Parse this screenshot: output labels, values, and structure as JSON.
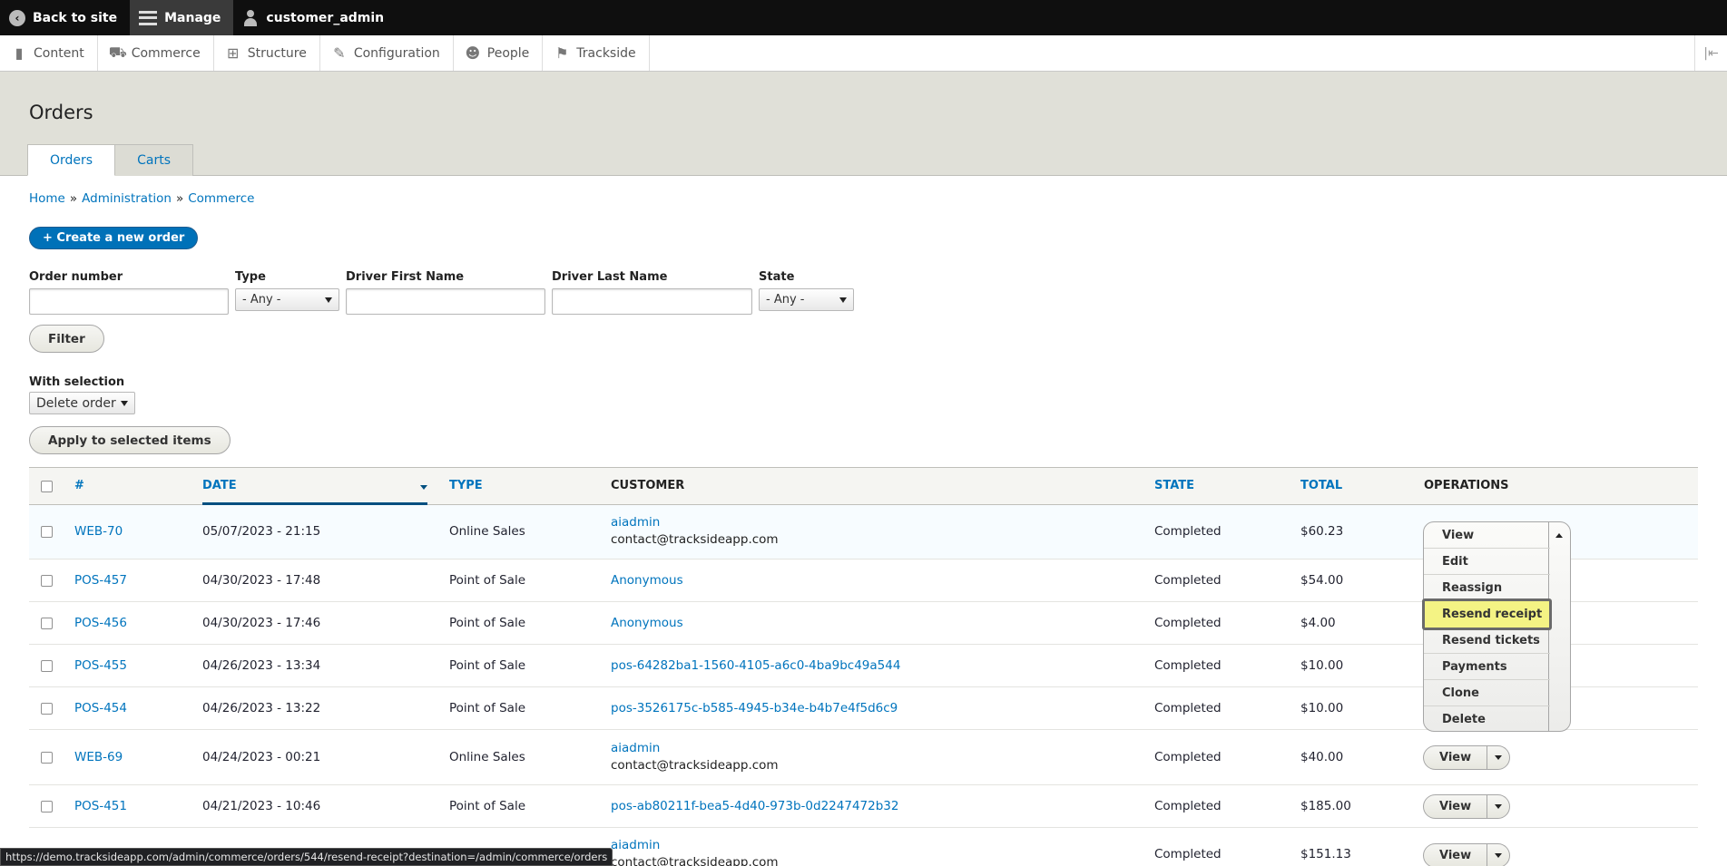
{
  "toolbar": {
    "back_label": "Back to site",
    "manage_label": "Manage",
    "user_label": "customer_admin"
  },
  "tray": {
    "items": [
      {
        "label": "Content",
        "icon": "file-icon"
      },
      {
        "label": "Commerce",
        "icon": "cart-icon"
      },
      {
        "label": "Structure",
        "icon": "sitemap-icon"
      },
      {
        "label": "Configuration",
        "icon": "wrench-icon"
      },
      {
        "label": "People",
        "icon": "people-icon"
      },
      {
        "label": "Trackside",
        "icon": "flag-icon"
      }
    ]
  },
  "page": {
    "title": "Orders",
    "tabs": [
      {
        "label": "Orders"
      },
      {
        "label": "Carts"
      }
    ]
  },
  "breadcrumb": {
    "items": [
      "Home",
      "Administration",
      "Commerce"
    ],
    "separator": "»"
  },
  "actions": {
    "create_label": "+ Create a new order"
  },
  "filters": {
    "order_number_label": "Order number",
    "type_label": "Type",
    "type_value": "- Any -",
    "first_name_label": "Driver First Name",
    "last_name_label": "Driver Last Name",
    "state_label": "State",
    "state_value": "- Any -",
    "filter_button": "Filter"
  },
  "bulk": {
    "label": "With selection",
    "value": "Delete order",
    "apply_button": "Apply to selected items"
  },
  "table": {
    "headers": {
      "number": "#",
      "date": "Date",
      "type": "Type",
      "customer": "Customer",
      "state": "State",
      "total": "Total",
      "operations": "Operations"
    },
    "rows": [
      {
        "number": "WEB-70",
        "date": "05/07/2023 - 21:15",
        "type": "Online Sales",
        "customer": "aiadmin",
        "email": "contact@tracksideapp.com",
        "state": "Completed",
        "total": "$60.23"
      },
      {
        "number": "POS-457",
        "date": "04/30/2023 - 17:48",
        "type": "Point of Sale",
        "customer": "Anonymous",
        "email": "",
        "state": "Completed",
        "total": "$54.00"
      },
      {
        "number": "POS-456",
        "date": "04/30/2023 - 17:46",
        "type": "Point of Sale",
        "customer": "Anonymous",
        "email": "",
        "state": "Completed",
        "total": "$4.00"
      },
      {
        "number": "POS-455",
        "date": "04/26/2023 - 13:34",
        "type": "Point of Sale",
        "customer": "pos-64282ba1-1560-4105-a6c0-4ba9bc49a544",
        "email": "",
        "state": "Completed",
        "total": "$10.00"
      },
      {
        "number": "POS-454",
        "date": "04/26/2023 - 13:22",
        "type": "Point of Sale",
        "customer": "pos-3526175c-b585-4945-b34e-b4b7e4f5d6c9",
        "email": "",
        "state": "Completed",
        "total": "$10.00"
      },
      {
        "number": "WEB-69",
        "date": "04/24/2023 - 00:21",
        "type": "Online Sales",
        "customer": "aiadmin",
        "email": "contact@tracksideapp.com",
        "state": "Completed",
        "total": "$40.00"
      },
      {
        "number": "POS-451",
        "date": "04/21/2023 - 10:46",
        "type": "Point of Sale",
        "customer": "pos-ab80211f-bea5-4d40-973b-0d2247472b32",
        "email": "",
        "state": "Completed",
        "total": "$185.00"
      },
      {
        "number": "",
        "date": "",
        "type": "",
        "customer": "aiadmin",
        "email": "contact@tracksideapp.com",
        "state": "Completed",
        "total": "$151.13"
      }
    ],
    "view_label": "View"
  },
  "operations_menu": {
    "items": [
      "View",
      "Edit",
      "Reassign",
      "Resend receipt",
      "Resend tickets",
      "Payments",
      "Clone",
      "Delete"
    ],
    "focused": "Resend receipt"
  },
  "status_url": "https://demo.tracksideapp.com/admin/commerce/orders/544/resend-receipt?destination=/admin/commerce/orders"
}
